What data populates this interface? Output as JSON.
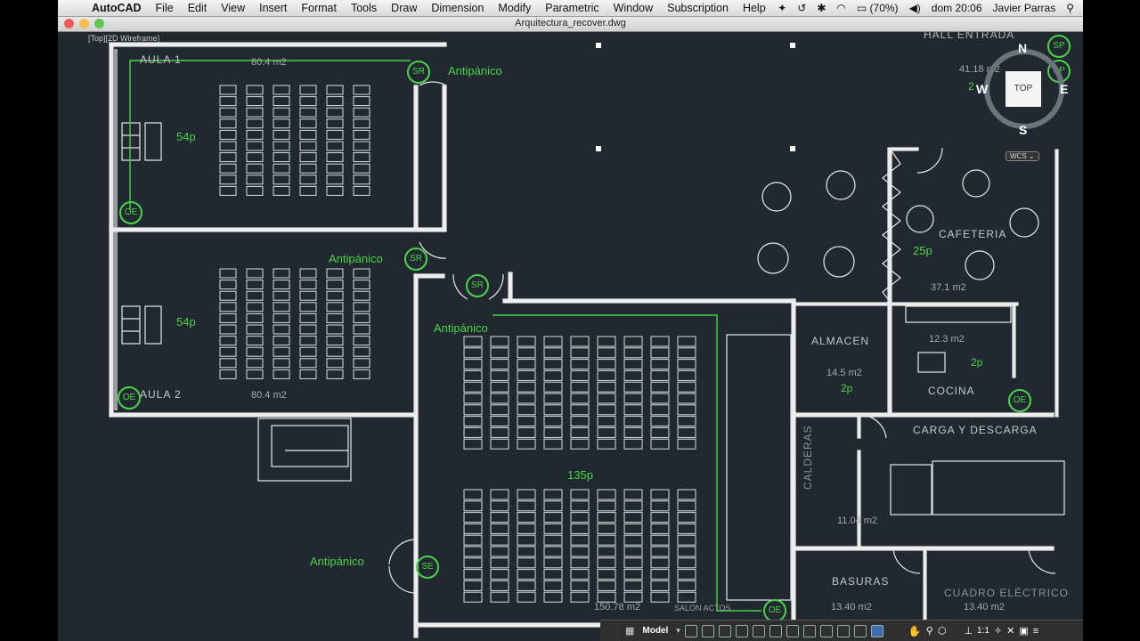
{
  "menubar": {
    "app": "AutoCAD",
    "menus": [
      "File",
      "Edit",
      "View",
      "Insert",
      "Format",
      "Tools",
      "Draw",
      "Dimension",
      "Modify",
      "Parametric",
      "Window",
      "Subscription",
      "Help"
    ],
    "battery": "(70%)",
    "clock": "dom 20:06",
    "user": "Javier Parras"
  },
  "window": {
    "title": "Arquitectura_recover.dwg"
  },
  "viewport": {
    "view": "Top",
    "style": "2D Wireframe"
  },
  "viewcube": {
    "north": "N",
    "south": "S",
    "east": "E",
    "west": "W",
    "face": "TOP"
  },
  "wcs": "WCS",
  "statusbar": {
    "model": "Model",
    "scale": "1:1"
  },
  "drawing": {
    "rooms": {
      "hall_entrada": "HALL ENTRADA",
      "hall_area": "41.18 m2",
      "hall_area_partial": "2",
      "aula1": "AULA 1",
      "aula1_area": "80.4 m2",
      "aula1_cap": "54p",
      "aula2": "AULA 2",
      "aula2_area": "80.4 m2",
      "aula2_cap": "54p",
      "cafeteria": "CAFETERIA",
      "cafeteria_cap": "25p",
      "cafeteria_area": "37.1 m2",
      "almacen": "ALMACEN",
      "almacen_area": "14.5 m2",
      "almacen_cap": "2p",
      "cocina": "COCINA",
      "cocina_area": "12.3 m2",
      "cocina_cap": "2p",
      "carga": "CARGA Y DESCARGA",
      "calderas": "CALDERAS",
      "calderas_area": "11.04 m2",
      "basuras": "BASURAS",
      "basuras_area": "13.40 m2",
      "cuadro": "CUADRO ELÉCTRICO",
      "cuadro_area": "13.40 m2",
      "salon_cap": "135p",
      "salon_area": "150.78 m2",
      "salon": "SALON ACTOS"
    },
    "antipanico": "Antipánico",
    "symbols": {
      "sr": "SR",
      "se": "SE",
      "oe": "OE",
      "sp": "SP"
    }
  }
}
